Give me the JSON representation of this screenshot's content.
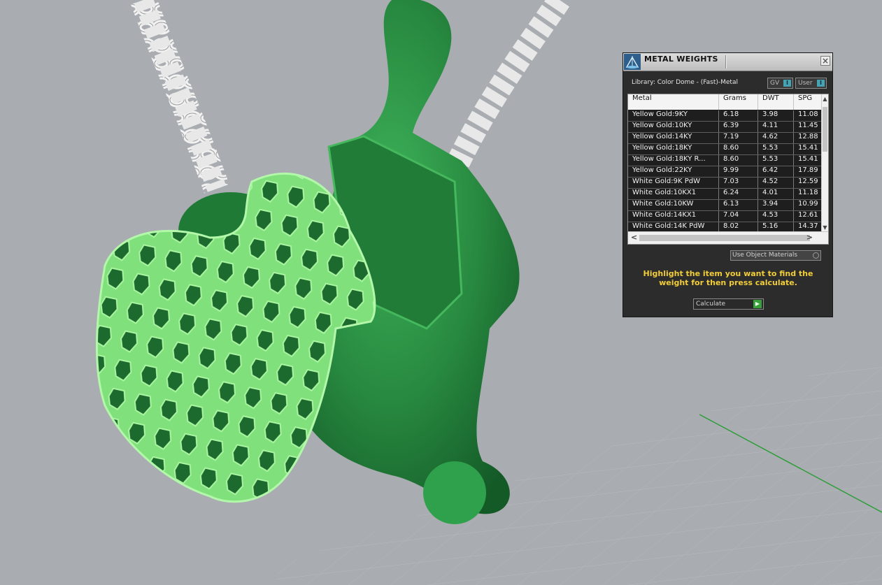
{
  "panel": {
    "title": "METAL WEIGHTS",
    "close_glyph": "×",
    "library_label": "Library: Color Dome - (Fast)-Metal",
    "gv_label": "GV",
    "user_label": "User",
    "indicator_glyph": "I",
    "table": {
      "headers": [
        "Metal",
        "Grams",
        "DWT",
        "SPG"
      ],
      "rows": [
        {
          "metal": "Yellow Gold:9KY",
          "grams": "6.18",
          "dwt": "3.98",
          "spg": "11.08"
        },
        {
          "metal": "Yellow Gold:10KY",
          "grams": "6.39",
          "dwt": "4.11",
          "spg": "11.45"
        },
        {
          "metal": "Yellow Gold:14KY",
          "grams": "7.19",
          "dwt": "4.62",
          "spg": "12.88"
        },
        {
          "metal": "Yellow Gold:18KY",
          "grams": "8.60",
          "dwt": "5.53",
          "spg": "15.41"
        },
        {
          "metal": "Yellow Gold:18KY R...",
          "grams": "8.60",
          "dwt": "5.53",
          "spg": "15.41"
        },
        {
          "metal": "Yellow Gold:22KY",
          "grams": "9.99",
          "dwt": "6.42",
          "spg": "17.89"
        },
        {
          "metal": "White Gold:9K PdW",
          "grams": "7.03",
          "dwt": "4.52",
          "spg": "12.59"
        },
        {
          "metal": "White Gold:10KX1",
          "grams": "6.24",
          "dwt": "4.01",
          "spg": "11.18"
        },
        {
          "metal": "White Gold:10KW",
          "grams": "6.13",
          "dwt": "3.94",
          "spg": "10.99"
        },
        {
          "metal": "White Gold:14KX1",
          "grams": "7.04",
          "dwt": "4.53",
          "spg": "12.61"
        },
        {
          "metal": "White Gold:14K PdW",
          "grams": "8.02",
          "dwt": "5.16",
          "spg": "14.37"
        }
      ]
    },
    "use_object_materials": "Use Object Materials",
    "instruction": "Highlight the item you want to find the weight for then press calculate.",
    "calculate_label": "Calculate",
    "scroll_up_glyph": "▲",
    "scroll_down_glyph": "▼",
    "scroll_left_glyph": "<",
    "scroll_right_glyph": ">",
    "play_glyph": "▶"
  },
  "colors": {
    "viewport_bg": "#a9adb1",
    "model_green": "#2d9446",
    "highlight_green": "#7fe07c",
    "chain": "#e4e4e4",
    "accent_yellow": "#f2cd3a",
    "axis_green": "#2f9c3a"
  }
}
